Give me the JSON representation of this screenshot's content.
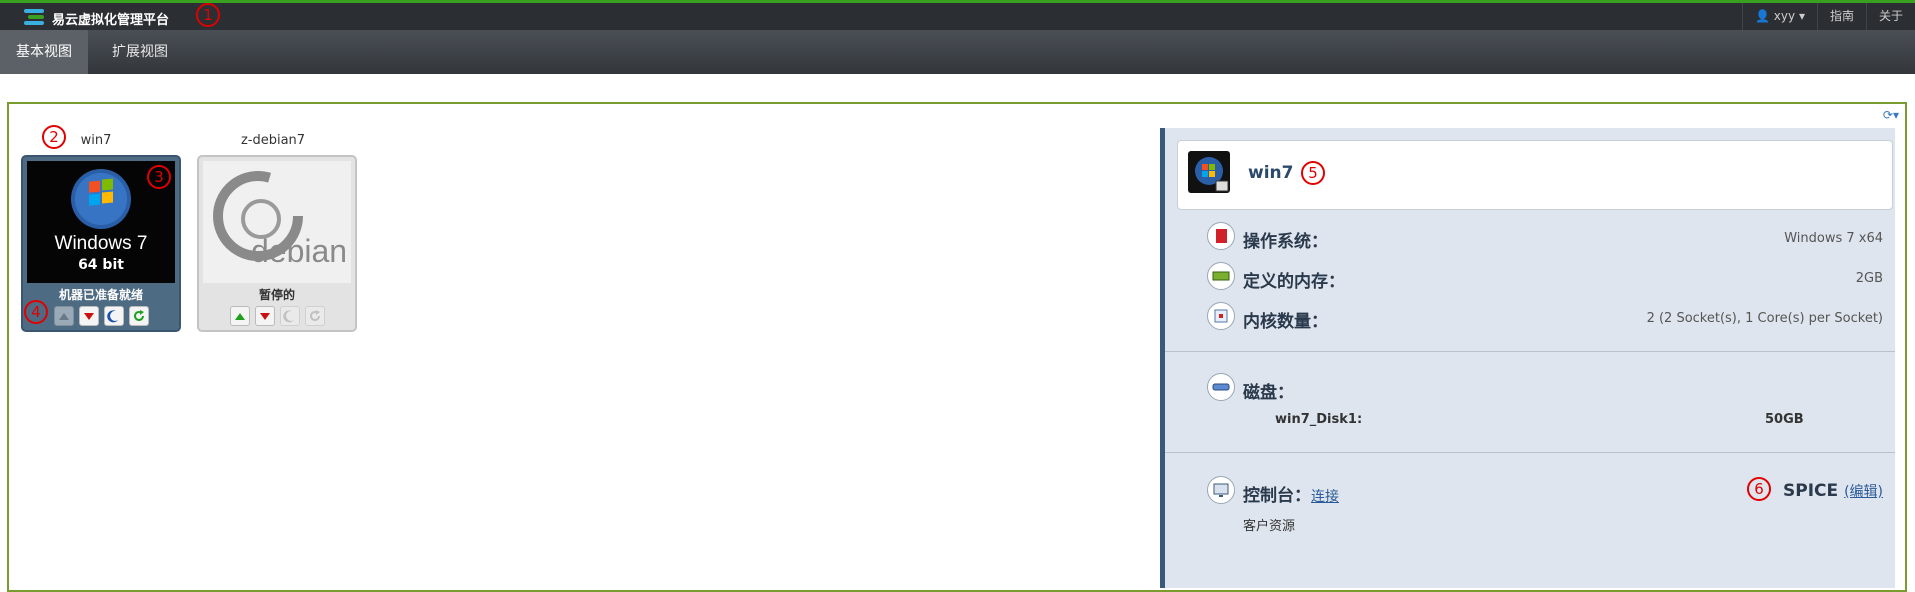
{
  "app": {
    "title": "易云虚拟化管理平台",
    "user": "xyy",
    "guide": "指南",
    "about": "关于"
  },
  "tabs": [
    {
      "label": "基本视图",
      "active": true
    },
    {
      "label": "扩展视图",
      "active": false
    }
  ],
  "markers": [
    "1",
    "2",
    "3",
    "4",
    "5",
    "6"
  ],
  "vms": [
    {
      "name": "win7",
      "thumb_line1": "Windows 7",
      "thumb_line2": "64 bit",
      "status": "机器已准备就绪",
      "state": "running"
    },
    {
      "name": "z-debian7",
      "thumb_text": "debian",
      "status": "暂停的",
      "state": "paused"
    }
  ],
  "detail": {
    "name": "win7",
    "os_label": "操作系统：",
    "os_value": "Windows 7 x64",
    "mem_label": "定义的内存：",
    "mem_value": "2GB",
    "cores_label": "内核数量：",
    "cores_value": "2 (2 Socket(s), 1 Core(s) per Socket)",
    "disk_label": "磁盘：",
    "disk_name": "win7_Disk1:",
    "disk_size": "50GB",
    "console_label": "控制台：",
    "console_link": "连接",
    "console_type": "SPICE",
    "console_edit": "(编辑)",
    "guest_resources": "客户资源"
  },
  "colors": {
    "accent_green": "#3aa020",
    "marker_red": "#e00000",
    "detail_bg": "#dfe5ee"
  }
}
